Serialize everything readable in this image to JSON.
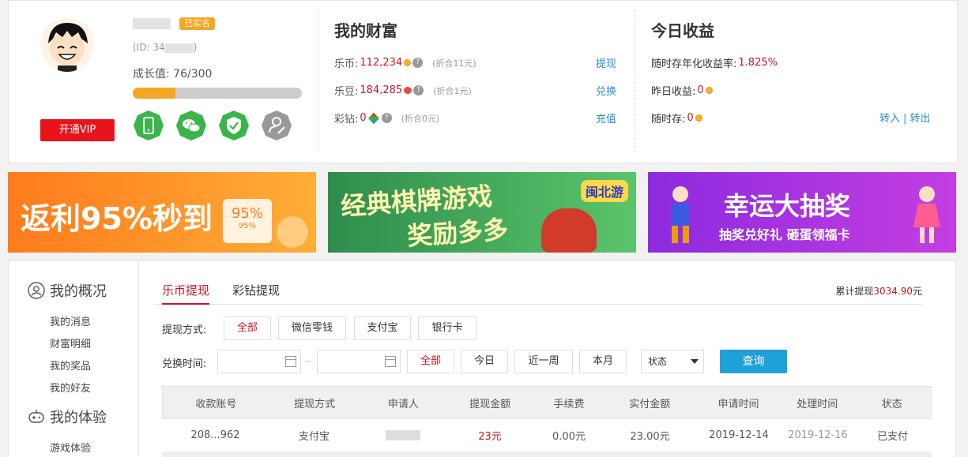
{
  "profile": {
    "verified_badge": "已实名",
    "id_prefix": "(ID: 34",
    "id_suffix": ")",
    "growth_label": "成长值:",
    "growth_value": "76/300",
    "growth_progress": 0.253,
    "vip_button": "开通VIP",
    "badges": [
      "phone-icon",
      "wechat-icon",
      "shield-check-icon",
      "user-verify-icon"
    ]
  },
  "wealth": {
    "title": "我的财富",
    "rows": [
      {
        "label": "乐币:",
        "value": "112,234",
        "note": "(折合11元)",
        "action": "提现"
      },
      {
        "label": "乐豆:",
        "value": "184,285",
        "note": "(折合1元)",
        "action": "兑换"
      },
      {
        "label": "彩钻:",
        "value": "0",
        "note": "(折合0元)",
        "action": "充值"
      }
    ]
  },
  "earnings": {
    "title": "今日收益",
    "rate_label": "随时存年化收益率:",
    "rate_value": "1.825%",
    "yesterday_label": "昨日收益:",
    "yesterday_value": "0",
    "deposit_label": "随时存:",
    "deposit_value": "0",
    "transfer_in": "转入",
    "transfer_sep": "|",
    "transfer_out": "转出"
  },
  "banners": [
    {
      "text": "返利95%秒到",
      "sub": "95%",
      "sub2": "95%"
    },
    {
      "text1": "经典棋牌游戏",
      "text2": "奖励多多",
      "logo": "闽北游"
    },
    {
      "text1": "幸运大抽奖",
      "text2": "抽奖兑好礼 砸蛋领福卡"
    }
  ],
  "nav": {
    "overview_title": "我的概况",
    "overview_items": [
      "我的消息",
      "财富明细",
      "我的奖品",
      "我的好友"
    ],
    "experience_title": "我的体验",
    "experience_items": [
      "游戏体验"
    ]
  },
  "withdraw": {
    "tabs": [
      "乐币提现",
      "彩钻提现"
    ],
    "total_label": "累计提现",
    "total_value": "3034.90",
    "total_unit": "元",
    "method_label": "提现方式:",
    "methods": [
      "全部",
      "微信零钱",
      "支付宝",
      "银行卡"
    ],
    "time_label": "兑换时间:",
    "time_filters": [
      "全部",
      "今日",
      "近一周",
      "本月"
    ],
    "status_select": "状态",
    "query_button": "查询"
  },
  "table": {
    "headers": [
      "收款账号",
      "提现方式",
      "申请人",
      "提现金额",
      "手续费",
      "实付金额",
      "申请时间",
      "处理时间",
      "状态"
    ],
    "rows": [
      {
        "account": "208...962",
        "method": "支付宝",
        "amount": "23元",
        "fee": "0.00元",
        "paid": "23.00元",
        "applied": "2019-12-14",
        "processed": "2019-12-16",
        "status": "已支付"
      }
    ]
  },
  "colors": {
    "accent_red": "#c81623",
    "link_blue": "#2b8ec8",
    "badge_green": "#3ab54a",
    "progress_orange": "#f5a623",
    "query_blue": "#1ea0d8"
  }
}
